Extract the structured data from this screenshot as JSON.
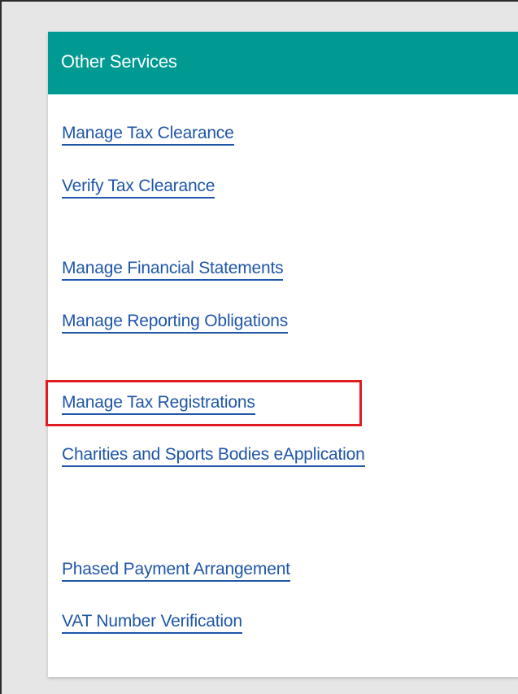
{
  "panel": {
    "title": "Other Services",
    "header_color": "#009a92"
  },
  "links": [
    {
      "label": "Manage Tax Clearance"
    },
    {
      "label": "Verify Tax Clearance"
    },
    {
      "label": "Manage Financial Statements"
    },
    {
      "label": "Manage Reporting Obligations"
    },
    {
      "label": "Manage Tax Registrations",
      "highlighted": true
    },
    {
      "label": "Charities and Sports Bodies eApplication"
    },
    {
      "label": "Phased Payment Arrangement"
    },
    {
      "label": "VAT Number Verification"
    }
  ],
  "colors": {
    "link": "#1f56a8",
    "highlight_border": "#e11b22"
  }
}
